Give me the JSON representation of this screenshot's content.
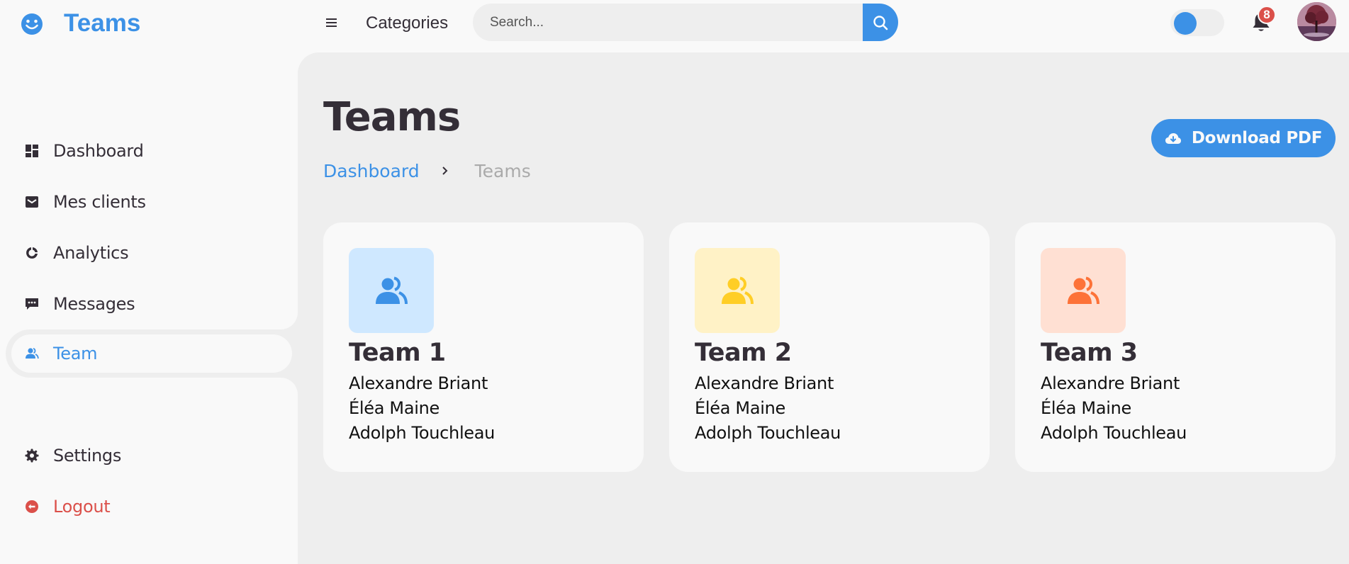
{
  "brand": {
    "name": "Teams",
    "icon": "smile-icon"
  },
  "navbar": {
    "categories_label": "Categories",
    "search_placeholder": "Search...",
    "notification_count": "8"
  },
  "sidebar": {
    "items": [
      {
        "label": "Dashboard",
        "icon": "dashboard-icon"
      },
      {
        "label": "Mes clients",
        "icon": "store-icon"
      },
      {
        "label": "Analytics",
        "icon": "doughnut-chart-icon"
      },
      {
        "label": "Messages",
        "icon": "message-dots-icon"
      },
      {
        "label": "Team",
        "icon": "group-icon",
        "active": true
      }
    ],
    "bottom": [
      {
        "label": "Settings",
        "icon": "cog-icon"
      },
      {
        "label": "Logout",
        "icon": "logout-icon"
      }
    ]
  },
  "main": {
    "title": "Teams",
    "breadcrumb": {
      "parent": "Dashboard",
      "current": "Teams"
    },
    "download_label": "Download PDF",
    "teams": [
      {
        "name": "Team 1",
        "members": [
          "Alexandre Briant",
          "Éléa Maine",
          "Adolph Touchleau"
        ],
        "color": "#3c91e6",
        "bg": "#cfe8ff"
      },
      {
        "name": "Team 2",
        "members": [
          "Alexandre Briant",
          "Éléa Maine",
          "Adolph Touchleau"
        ],
        "color": "#ffce26",
        "bg": "#fff2c6"
      },
      {
        "name": "Team 3",
        "members": [
          "Alexandre Briant",
          "Éléa Maine",
          "Adolph Touchleau"
        ],
        "color": "#fd7238",
        "bg": "#ffe0d3"
      }
    ]
  },
  "colors": {
    "accent": "#3c91e6",
    "danger": "#db504a",
    "dark": "#342e37",
    "light": "#f9f9f9",
    "grey": "#eeeeee"
  }
}
